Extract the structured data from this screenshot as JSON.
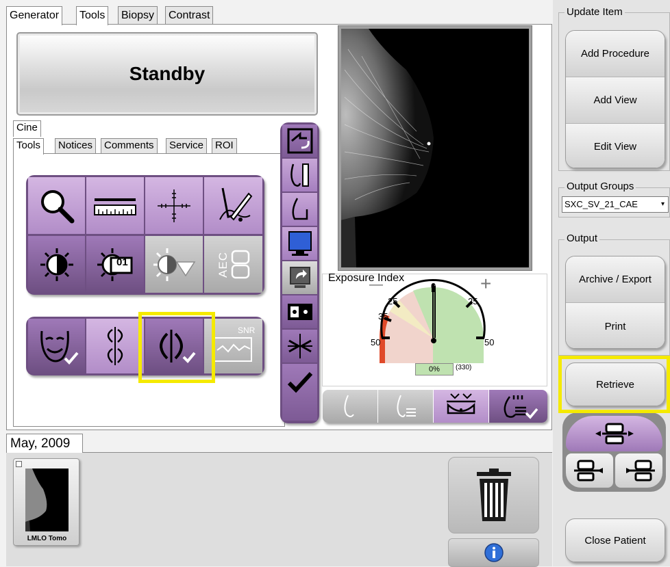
{
  "top_tabs": [
    {
      "label": "Generator",
      "active": false
    },
    {
      "label": "Tools",
      "active": true
    },
    {
      "label": "Biopsy",
      "active": false
    },
    {
      "label": "Contrast",
      "active": false
    }
  ],
  "status": {
    "label": "Standby"
  },
  "cine_tab": "Cine",
  "sub_tabs": [
    {
      "label": "Tools",
      "active": true
    },
    {
      "label": "Notices",
      "active": false
    },
    {
      "label": "Comments",
      "active": false
    },
    {
      "label": "Service",
      "active": false
    },
    {
      "label": "ROI",
      "active": false
    }
  ],
  "tool_icons": {
    "row1": [
      "magnifier-icon",
      "ruler-icon",
      "crosshair-icon",
      "freehand-annotation-icon"
    ],
    "row2": [
      "window-level-icon",
      "window-level-preset-icon",
      "contrast-dropdown-icon",
      "aec-icon"
    ],
    "row3": [
      "face-check-icon",
      "symmetry-icon",
      "symmetry-check-icon",
      "snr-icon"
    ],
    "aec_text": "AEC",
    "preset_text": "01",
    "snr_text": "SNR"
  },
  "vertical_toolbar": [
    "switch-view-icon",
    "breast-measure-icon",
    "breast-implant-icon",
    "monitor-icon",
    "send-icon",
    "pair-icon",
    "compress-icon",
    "accept-check-icon"
  ],
  "exposure_index": {
    "title": "Exposure Index",
    "minus": "—",
    "plus": "+",
    "scale_labels": [
      "0",
      "25",
      "25",
      "35",
      "50",
      "50"
    ],
    "percent_text": "0%",
    "count_text": "(330)",
    "needle_value": 0
  },
  "bottom_strip": [
    "breast-outline-icon",
    "breast-lines-icon",
    "compression-paddle-icon",
    "breast-implant-check-icon"
  ],
  "right_panel": {
    "update_item_label": "Update Item",
    "update_buttons": [
      "Add Procedure",
      "Add View",
      "Edit View"
    ],
    "output_groups_label": "Output Groups",
    "output_groups_value": "SXC_SV_21_CAE",
    "output_label": "Output",
    "output_buttons": [
      "Archive / Export",
      "Print"
    ],
    "retrieve": "Retrieve",
    "close_patient": "Close Patient"
  },
  "thumbnails": {
    "date_tab": "May, 2009",
    "items": [
      {
        "label": "LMLO Tomo"
      }
    ]
  },
  "colors": {
    "purple_dark": "#6e4f82",
    "purple_light": "#c8a7d8",
    "highlight": "#f5ea00",
    "gauge_green": "#bfe2b0",
    "gauge_red": "#e04a2a"
  }
}
